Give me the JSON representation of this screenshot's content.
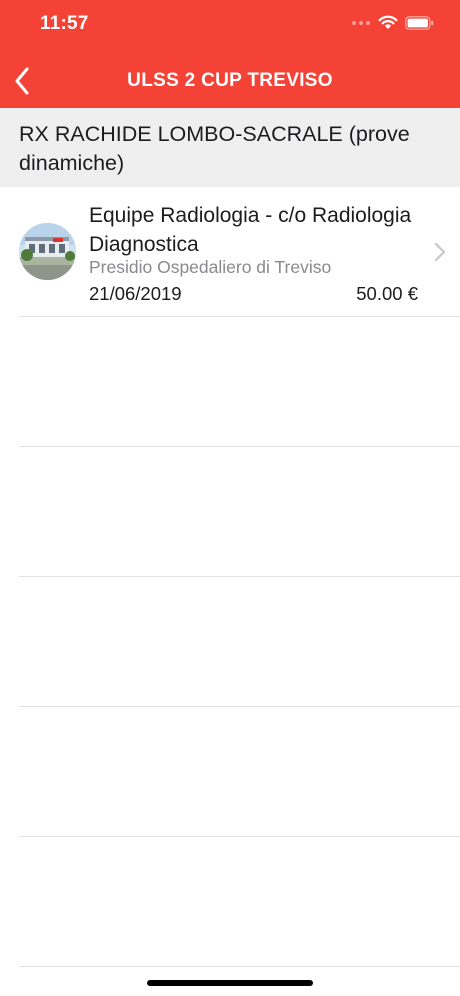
{
  "status_bar": {
    "time": "11:57"
  },
  "nav": {
    "title": "ULSS 2 CUP TREVISO"
  },
  "section": {
    "title": "RX RACHIDE LOMBO-SACRALE (prove dinamiche)"
  },
  "results": [
    {
      "title": "Equipe Radiologia - c/o Radiologia Diagnostica",
      "subtitle": "Presidio Ospedaliero di Treviso",
      "date": "21/06/2019",
      "price": "50.00 €"
    }
  ],
  "colors": {
    "header": "#f44336",
    "section_background": "#efeff0",
    "separator": "#e2e2e4",
    "subtitle_text": "#8a8a8e"
  },
  "icons": [
    "back-chevron-icon",
    "wifi-icon",
    "battery-icon",
    "chevron-right-icon",
    "hospital-thumbnail"
  ]
}
